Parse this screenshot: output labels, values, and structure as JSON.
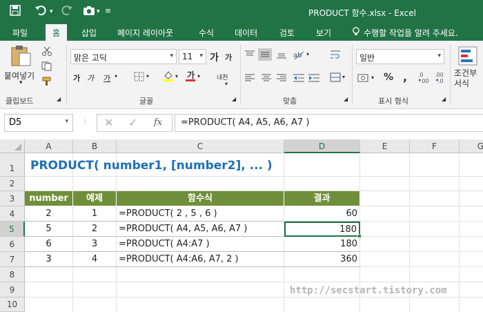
{
  "titlebar": {
    "title": "PRODUCT 함수.xlsx - Excel",
    "icons": [
      "save-icon",
      "undo-icon",
      "redo-icon",
      "camera-icon",
      "customize-icon"
    ]
  },
  "tabs": [
    {
      "label": "파일"
    },
    {
      "label": "홈"
    },
    {
      "label": "삽입"
    },
    {
      "label": "페이지 레이아웃"
    },
    {
      "label": "수식"
    },
    {
      "label": "데이터"
    },
    {
      "label": "검토"
    },
    {
      "label": "보기"
    }
  ],
  "tellme": "수행할 작업을 알려 주세요.",
  "ribbon": {
    "paste_label": "붙여넣기",
    "clipboard_label": "클립보드",
    "font_label": "글꼴",
    "align_label": "맞춤",
    "number_label": "표시 형식",
    "font_name": "맑은 고딕",
    "font_size": "11",
    "number_format": "일반",
    "conditional_label": "조건부 서식",
    "bold": "가",
    "italic": "가",
    "underline": "가",
    "grow": "가",
    "shrink": "가",
    "percent": "%",
    "comma": ",",
    "wrap_label": "내"
  },
  "formula_bar": {
    "name_box": "D5",
    "formula": "=PRODUCT( A4, A5, A6, A7 )"
  },
  "columns": [
    "A",
    "B",
    "C",
    "D",
    "E",
    "F",
    "G"
  ],
  "rows": [
    "1",
    "2",
    "3",
    "4",
    "5",
    "6",
    "7",
    "8",
    "9",
    "10"
  ],
  "sheet": {
    "title": "PRODUCT( number1, [number2], ... )",
    "headers": [
      "number",
      "예제",
      "함수식",
      "결과"
    ],
    "data": [
      {
        "number": "2",
        "example": "1",
        "formula": "=PRODUCT( 2 , 5 , 6 )",
        "result": "60"
      },
      {
        "number": "5",
        "example": "2",
        "formula": "=PRODUCT( A4, A5, A6, A7 )",
        "result": "180"
      },
      {
        "number": "6",
        "example": "3",
        "formula": "=PRODUCT( A4:A7 )",
        "result": "180"
      },
      {
        "number": "3",
        "example": "4",
        "formula": "=PRODUCT( A4:A6, A7, 2 )",
        "result": "360"
      }
    ],
    "watermark": "http://secstart.tistory.com"
  },
  "colors": {
    "accent": "#217346",
    "header_fill": "#6f8f3a",
    "title_text": "#1f6fb4"
  }
}
